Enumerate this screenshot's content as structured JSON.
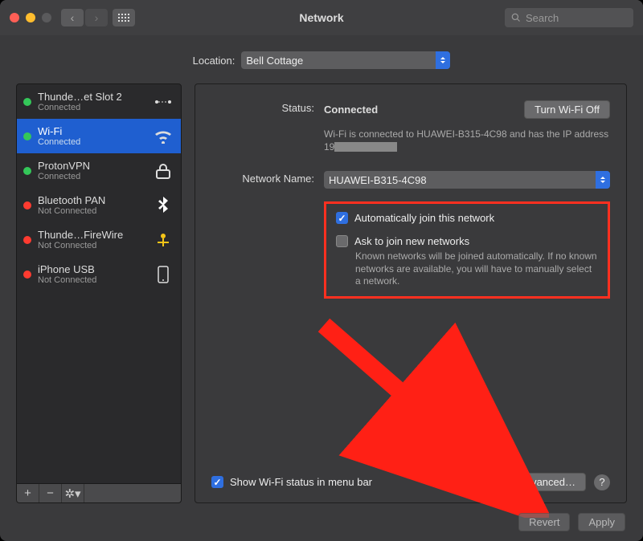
{
  "window": {
    "title": "Network",
    "search_placeholder": "Search"
  },
  "location": {
    "label": "Location:",
    "value": "Bell Cottage"
  },
  "sidebar": {
    "items": [
      {
        "name": "Thunde…et Slot 2",
        "status": "Connected",
        "dot": "green",
        "icon": "thunderbolt-bridge"
      },
      {
        "name": "Wi-Fi",
        "status": "Connected",
        "dot": "green",
        "icon": "wifi",
        "selected": true
      },
      {
        "name": "ProtonVPN",
        "status": "Connected",
        "dot": "green",
        "icon": "vpn"
      },
      {
        "name": "Bluetooth PAN",
        "status": "Not Connected",
        "dot": "red",
        "icon": "bluetooth"
      },
      {
        "name": "Thunde…FireWire",
        "status": "Not Connected",
        "dot": "red",
        "icon": "firewire"
      },
      {
        "name": "iPhone USB",
        "status": "Not Connected",
        "dot": "red",
        "icon": "iphone"
      }
    ]
  },
  "main": {
    "status_label": "Status:",
    "status_value": "Connected",
    "turn_off": "Turn Wi-Fi Off",
    "status_desc_a": "Wi-Fi is connected to HUAWEI-B315-4C98 and has the IP address 19",
    "network_name_label": "Network Name:",
    "network_name_value": "HUAWEI-B315-4C98",
    "auto_join": "Automatically join this network",
    "ask_join": "Ask to join new networks",
    "ask_desc": "Known networks will be joined automatically. If no known networks are available, you will have to manually select a network.",
    "show_status": "Show Wi-Fi status in menu bar",
    "advanced": "Advanced…"
  },
  "footer": {
    "revert": "Revert",
    "apply": "Apply"
  }
}
